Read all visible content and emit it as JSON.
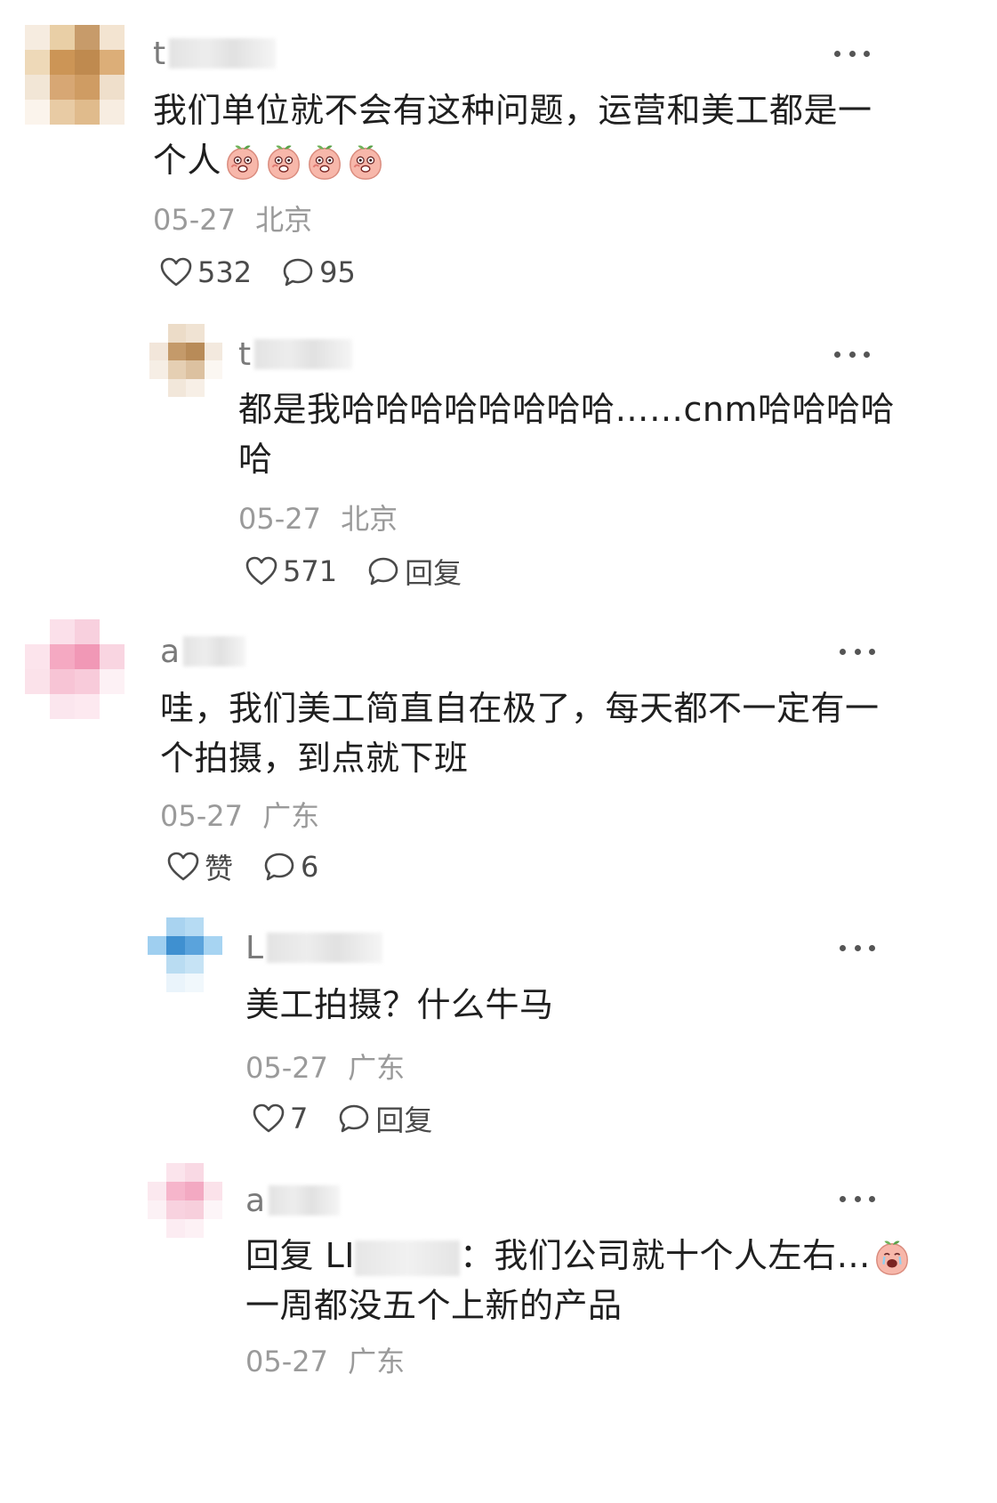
{
  "comments": [
    {
      "user_initial": "t",
      "text_lines": [
        "我们单位就不会有这种问题，运营和美工都是一",
        "个人"
      ],
      "emoji_count": 4,
      "date": "05-27",
      "location": "北京",
      "like_label": "532",
      "reply_label": "95",
      "avatar_colors": [
        "#f6ece0",
        "#e9cfa6",
        "#c79b6a",
        "#f3e4d1",
        "#eed9b8",
        "#cc9556",
        "#bf8a4f",
        "#dcae78",
        "#f2e6d6",
        "#d7a774",
        "#cf9c63",
        "#efdfcb",
        "#fbf4ec",
        "#e8cba4",
        "#e0bb8c",
        "#f7ede1"
      ]
    },
    {
      "user_initial": "t",
      "text_lines": [
        "都是我哈哈哈哈哈哈哈哈……cnm哈哈哈哈",
        "哈"
      ],
      "date": "05-27",
      "location": "北京",
      "like_label": "571",
      "reply_label": "回复",
      "avatar_colors": [
        "#ffffff",
        "#ecdcc8",
        "#f0e3d3",
        "#ffffff",
        "#f2e6da",
        "#c49a6a",
        "#b88b58",
        "#f3e9de",
        "#f6eee5",
        "#e5cfb3",
        "#dcc1a0",
        "#fbf7f2",
        "#ffffff",
        "#f2e7da",
        "#f7efe6",
        "#ffffff"
      ]
    },
    {
      "user_initial": "a",
      "text_lines": [
        "哇，我们美工简直自在极了，每天都不一定有一",
        "个拍摄，到点就下班"
      ],
      "date": "05-27",
      "location": "广东",
      "like_label": "赞",
      "reply_label": "6",
      "avatar_colors": [
        "#ffffff",
        "#fbe0ea",
        "#f8d0de",
        "#ffffff",
        "#fce4ec",
        "#f5a9c2",
        "#f198b6",
        "#f9d5e1",
        "#fbe2ea",
        "#f7c4d5",
        "#f8cbda",
        "#fdf1f5",
        "#ffffff",
        "#fbe6ee",
        "#fde9f0",
        "#ffffff"
      ]
    },
    {
      "user_initial": "L",
      "text_lines": [
        "美工拍摄？什么牛马"
      ],
      "date": "05-27",
      "location": "广东",
      "like_label": "7",
      "reply_label": "回复",
      "avatar_colors": [
        "#ffffff",
        "#a9d3f0",
        "#b6dbf3",
        "#ffffff",
        "#9fcff0",
        "#3f90d0",
        "#5aa3dc",
        "#a7d4f2",
        "#ffffff",
        "#b9dcf2",
        "#c6e3f5",
        "#ffffff",
        "#ffffff",
        "#eaf4fb",
        "#f1f8fc",
        "#ffffff"
      ]
    },
    {
      "user_initial": "a",
      "reply_prefix": "回复 LI",
      "reply_suffix": "：我们公司就十个人左右…",
      "text_lines": [
        "一周都没五个上新的产品"
      ],
      "date": "05-27",
      "location": "广东",
      "avatar_colors": [
        "#ffffff",
        "#fbe4ec",
        "#f9d9e4",
        "#ffffff",
        "#fbe8ef",
        "#f6b5cb",
        "#f3a9c2",
        "#fbe2ea",
        "#fcf1f5",
        "#f8d2df",
        "#f7cfdc",
        "#fdf5f8",
        "#ffffff",
        "#fcecf2",
        "#fdf1f5",
        "#ffffff"
      ]
    }
  ]
}
